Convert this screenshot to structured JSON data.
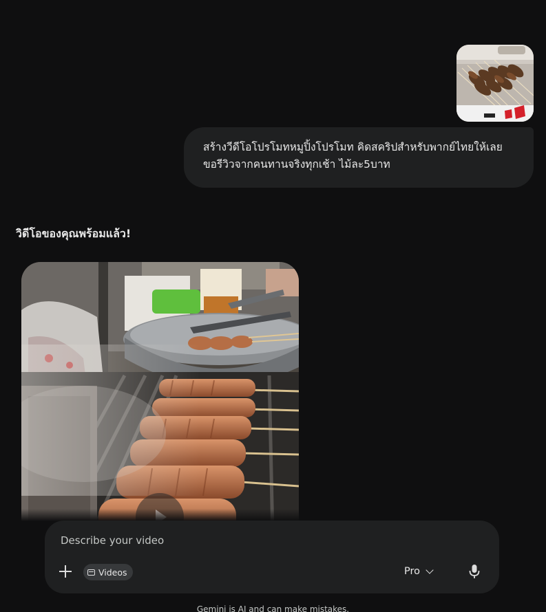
{
  "conversation": {
    "user_message": {
      "line_1": "สร้างวีดีโอโปรโมทหมูปิ้งโปรโมท คิดสคริปสำหรับพากย์ไทยให้เลย",
      "line_2": "ขอรีวิวจากคนทานจริงทุกเช้า ไม้ละ5บาท"
    },
    "response": {
      "heading": "วิดีโอของคุณพร้อมแล้ว!"
    }
  },
  "input": {
    "placeholder": "Describe your video",
    "value": "",
    "tool_chip": "Videos",
    "model": "Pro"
  },
  "footer": {
    "disclaimer": "Gemini is AI and can make mistakes."
  },
  "icons": {
    "add": "plus-icon",
    "tool_chip": "video-icon",
    "model_dropdown": "chevron-down-icon",
    "voice": "microphone-icon",
    "video_overlay": "play-icon"
  }
}
